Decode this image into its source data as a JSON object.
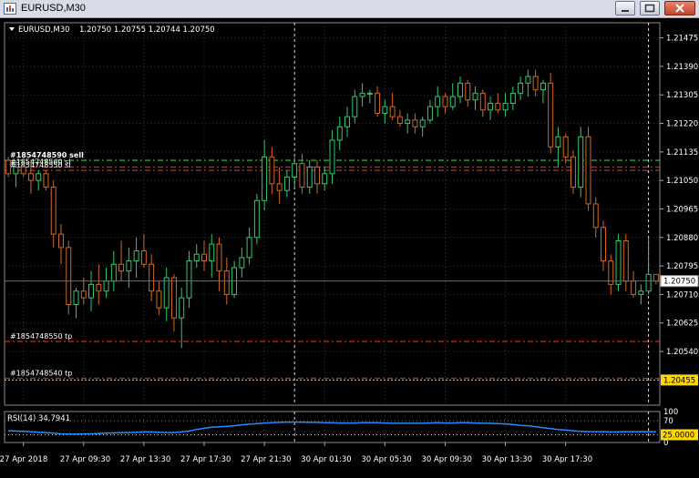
{
  "window": {
    "title": "EURUSD,M30"
  },
  "colors": {
    "bull": "#2ecc71",
    "bear": "#d2691e",
    "grid": "#3a3a3a",
    "axis": "#ffffff",
    "rsi": "#1e90ff",
    "orderLine": "#e0201f",
    "sellLine": "#2ecc40",
    "highlight": "#ffd700"
  },
  "chart_data": {
    "type": "candlestick",
    "symbol_header": "EURUSD,M30",
    "ohlc_header": "1.20750 1.20755 1.20744 1.20750",
    "ylim": [
      1.2038,
      1.2152
    ],
    "y_ticks": [
      "1.21475",
      "1.21390",
      "1.21305",
      "1.21220",
      "1.21135",
      "1.21050",
      "1.20965",
      "1.20880",
      "1.20795",
      "1.20710",
      "1.20625",
      "1.20540"
    ],
    "y_tick_values": [
      1.21475,
      1.2139,
      1.21305,
      1.2122,
      1.21135,
      1.2105,
      1.20965,
      1.2088,
      1.20795,
      1.2071,
      1.20625,
      1.2054
    ],
    "current_price": "1.20750",
    "current_price_value": 1.2075,
    "highlight_price": "1.20455",
    "highlight_price_value": 1.20455,
    "x_labels": [
      "27 Apr 2018",
      "27 Apr 09:30",
      "27 Apr 13:30",
      "27 Apr 17:30",
      "27 Apr 21:30",
      "30 Apr 01:30",
      "30 Apr 05:30",
      "30 Apr 09:30",
      "30 Apr 13:30",
      "30 Apr 17:30"
    ],
    "x_label_bars": [
      2,
      10,
      18,
      26,
      34,
      42,
      50,
      58,
      66,
      74
    ],
    "vlines_bars": [
      38,
      85
    ],
    "bars_shown": 87,
    "order_lines": [
      {
        "label": "#1854748590 sell",
        "price": 1.2111,
        "color": "#2ecc40"
      },
      {
        "label": "#1854748560 sl",
        "price": 1.2109,
        "color": "#e0201f"
      },
      {
        "label": "#1854748550 sl",
        "price": 1.2108,
        "color": "#e0201f"
      },
      {
        "label": "#1854748550 tp",
        "price": 1.2057,
        "color": "#e0201f"
      },
      {
        "label": "#1854748540 tp",
        "price": 1.2046,
        "color": "#e0201f"
      }
    ],
    "candles": [
      [
        1.2111,
        1.2112,
        1.2106,
        1.2107
      ],
      [
        1.2107,
        1.2111,
        1.2103,
        1.2109
      ],
      [
        1.2109,
        1.2111,
        1.2106,
        1.2107
      ],
      [
        1.2107,
        1.211,
        1.2101,
        1.2105
      ],
      [
        1.2105,
        1.2108,
        1.2102,
        1.2107
      ],
      [
        1.2107,
        1.2108,
        1.2102,
        1.2103
      ],
      [
        1.2103,
        1.2105,
        1.2085,
        1.2089
      ],
      [
        1.2089,
        1.2092,
        1.208,
        1.2085
      ],
      [
        1.2085,
        1.2087,
        1.2065,
        1.2068
      ],
      [
        1.2068,
        1.2073,
        1.2064,
        1.2072
      ],
      [
        1.2072,
        1.2076,
        1.2068,
        1.207
      ],
      [
        1.207,
        1.2078,
        1.2066,
        1.2074
      ],
      [
        1.2074,
        1.208,
        1.2068,
        1.2072
      ],
      [
        1.2072,
        1.2079,
        1.207,
        1.2075
      ],
      [
        1.2075,
        1.2084,
        1.2072,
        1.208
      ],
      [
        1.208,
        1.2087,
        1.2075,
        1.2078
      ],
      [
        1.2078,
        1.2085,
        1.2073,
        1.2081
      ],
      [
        1.2081,
        1.2088,
        1.2076,
        1.2084
      ],
      [
        1.2084,
        1.2089,
        1.2079,
        1.208
      ],
      [
        1.208,
        1.2083,
        1.2069,
        1.2072
      ],
      [
        1.2072,
        1.2075,
        1.2065,
        1.2067
      ],
      [
        1.2067,
        1.2079,
        1.2063,
        1.2076
      ],
      [
        1.2076,
        1.2077,
        1.206,
        1.2064
      ],
      [
        1.2064,
        1.2073,
        1.2055,
        1.207
      ],
      [
        1.207,
        1.2084,
        1.2067,
        1.2081
      ],
      [
        1.2081,
        1.2086,
        1.2079,
        1.2083
      ],
      [
        1.2083,
        1.2087,
        1.2078,
        1.2081
      ],
      [
        1.2081,
        1.2089,
        1.2076,
        1.2086
      ],
      [
        1.2086,
        1.2088,
        1.2072,
        1.2078
      ],
      [
        1.2078,
        1.2082,
        1.2068,
        1.2071
      ],
      [
        1.2071,
        1.2081,
        1.207,
        1.2079
      ],
      [
        1.2079,
        1.2085,
        1.2076,
        1.2082
      ],
      [
        1.2082,
        1.2091,
        1.208,
        1.2088
      ],
      [
        1.2088,
        1.2101,
        1.2086,
        1.2099
      ],
      [
        1.2099,
        1.2117,
        1.2096,
        1.2112
      ],
      [
        1.2112,
        1.2115,
        1.2101,
        1.2104
      ],
      [
        1.2104,
        1.2109,
        1.2098,
        1.2102
      ],
      [
        1.2102,
        1.2108,
        1.21,
        1.2106
      ],
      [
        1.2106,
        1.2112,
        1.2103,
        1.211
      ],
      [
        1.211,
        1.2113,
        1.2101,
        1.2103
      ],
      [
        1.2103,
        1.2111,
        1.2101,
        1.2109
      ],
      [
        1.2109,
        1.2111,
        1.2101,
        1.2104
      ],
      [
        1.2104,
        1.2109,
        1.2102,
        1.2107
      ],
      [
        1.2107,
        1.212,
        1.2104,
        1.2117
      ],
      [
        1.2117,
        1.2124,
        1.2114,
        1.2121
      ],
      [
        1.2121,
        1.2127,
        1.2118,
        1.2124
      ],
      [
        1.2124,
        1.2132,
        1.2122,
        1.213
      ],
      [
        1.213,
        1.2134,
        1.2127,
        1.2131
      ],
      [
        1.2131,
        1.2132,
        1.2128,
        1.2131
      ],
      [
        1.2131,
        1.2133,
        1.2124,
        1.2125
      ],
      [
        1.2125,
        1.2129,
        1.2122,
        1.2127
      ],
      [
        1.2127,
        1.2131,
        1.2123,
        1.2124
      ],
      [
        1.2124,
        1.2126,
        1.2121,
        1.2122
      ],
      [
        1.2122,
        1.2125,
        1.2119,
        1.2123
      ],
      [
        1.2123,
        1.2125,
        1.2119,
        1.2121
      ],
      [
        1.2121,
        1.2124,
        1.2118,
        1.2123
      ],
      [
        1.2123,
        1.2129,
        1.2122,
        1.2127
      ],
      [
        1.2127,
        1.2133,
        1.2124,
        1.213
      ],
      [
        1.213,
        1.2131,
        1.2125,
        1.2127
      ],
      [
        1.2127,
        1.2134,
        1.2126,
        1.213
      ],
      [
        1.213,
        1.2136,
        1.2128,
        1.2134
      ],
      [
        1.2134,
        1.2135,
        1.2127,
        1.2129
      ],
      [
        1.2129,
        1.2133,
        1.2126,
        1.2131
      ],
      [
        1.2131,
        1.2132,
        1.2124,
        1.2126
      ],
      [
        1.2126,
        1.213,
        1.2123,
        1.2128
      ],
      [
        1.2128,
        1.2131,
        1.2125,
        1.2126
      ],
      [
        1.2126,
        1.2131,
        1.2124,
        1.2128
      ],
      [
        1.2128,
        1.2133,
        1.2126,
        1.2131
      ],
      [
        1.2131,
        1.2136,
        1.2129,
        1.2134
      ],
      [
        1.2134,
        1.2138,
        1.213,
        1.2136
      ],
      [
        1.2136,
        1.2138,
        1.213,
        1.2132
      ],
      [
        1.2132,
        1.2135,
        1.2128,
        1.2134
      ],
      [
        1.2134,
        1.2137,
        1.2113,
        1.2115
      ],
      [
        1.2115,
        1.2121,
        1.2109,
        1.2118
      ],
      [
        1.2118,
        1.2119,
        1.211,
        1.2112
      ],
      [
        1.2112,
        1.2114,
        1.2101,
        1.2103
      ],
      [
        1.2103,
        1.2121,
        1.21,
        1.2118
      ],
      [
        1.2118,
        1.2121,
        1.2096,
        1.2098
      ],
      [
        1.2098,
        1.21,
        1.2088,
        1.2091
      ],
      [
        1.2091,
        1.2093,
        1.2078,
        1.2081
      ],
      [
        1.2081,
        1.2083,
        1.2071,
        1.2074
      ],
      [
        1.2074,
        1.2089,
        1.2072,
        1.2087
      ],
      [
        1.2087,
        1.2089,
        1.2072,
        1.2075
      ],
      [
        1.2075,
        1.2078,
        1.207,
        1.2071
      ],
      [
        1.2071,
        1.2074,
        1.2068,
        1.2072
      ],
      [
        1.2072,
        1.2088,
        1.2071,
        1.2077
      ],
      [
        1.2077,
        1.2077,
        1.2074,
        1.2075
      ]
    ],
    "rsi": {
      "label": "RSI(14) 34.7941",
      "ylim": [
        0,
        100
      ],
      "ticks": [
        "100",
        "70",
        "25.0000",
        "0"
      ],
      "tick_values": [
        100,
        70,
        25,
        0
      ],
      "values": [
        38,
        37,
        36,
        35,
        33,
        32,
        30,
        28,
        27,
        27,
        28,
        28,
        29,
        30,
        31,
        32,
        32,
        33,
        34,
        34,
        33,
        32,
        32,
        34,
        37,
        42,
        46,
        49,
        51,
        52,
        54,
        57,
        59,
        61,
        63,
        64,
        65,
        66,
        66,
        66,
        65,
        65,
        64,
        64,
        63,
        63,
        63,
        64,
        64,
        64,
        63,
        62,
        62,
        62,
        62,
        62,
        63,
        64,
        63,
        63,
        64,
        64,
        63,
        62,
        62,
        61,
        60,
        58,
        55,
        54,
        51,
        48,
        45,
        42,
        40,
        38,
        36,
        35,
        35,
        35,
        34,
        34,
        35,
        35,
        35,
        35,
        35
      ]
    }
  }
}
